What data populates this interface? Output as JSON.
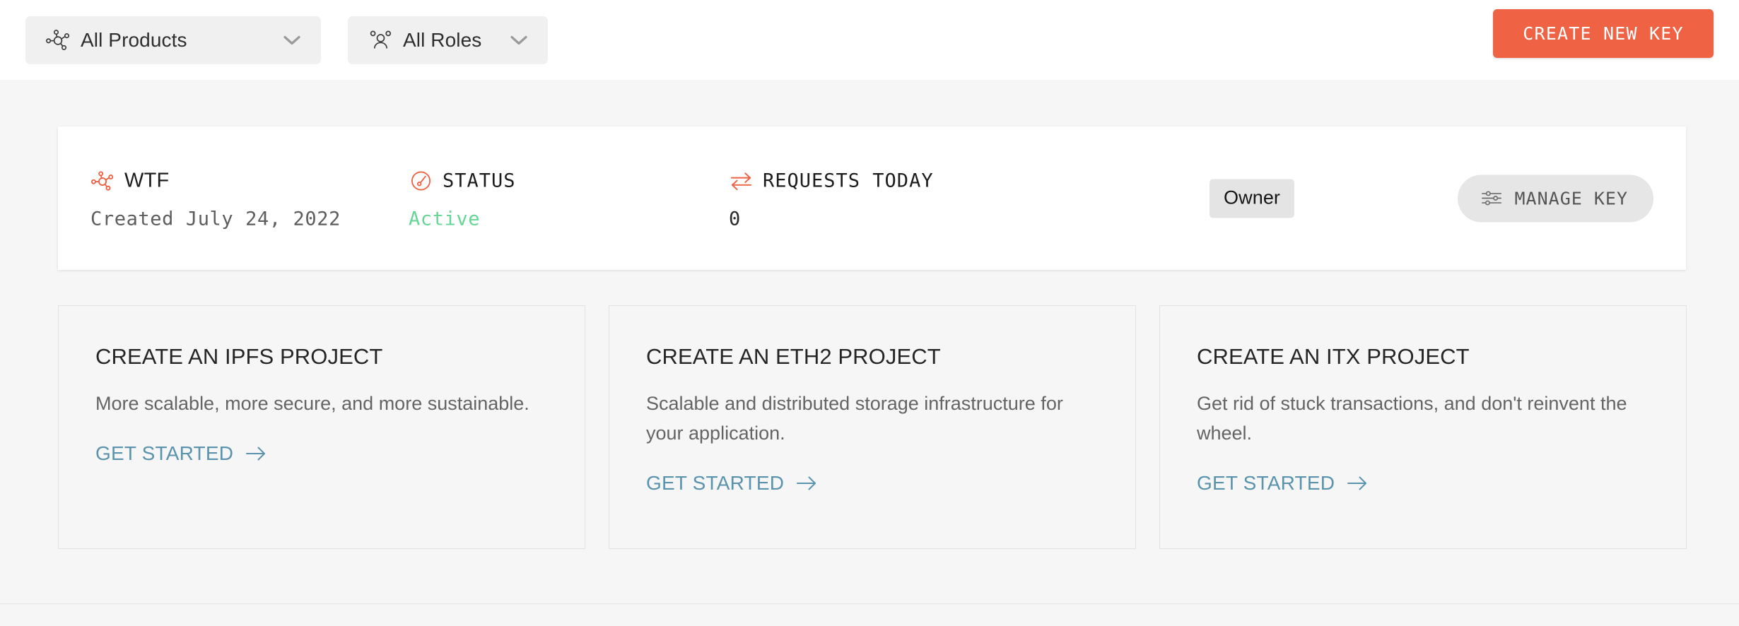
{
  "topbar": {
    "filters": [
      {
        "label": "All Products",
        "icon": "network-nodes-icon",
        "caret": "chevron-down-icon"
      },
      {
        "label": "All Roles",
        "icon": "users-group-icon",
        "caret": "chevron-down-icon"
      }
    ],
    "create_key_label": "CREATE NEW KEY"
  },
  "key_card": {
    "name_icon": "network-nodes-icon",
    "name": "WTF",
    "created": "Created July 24, 2022",
    "status_icon": "gauge-icon",
    "status_heading": "STATUS",
    "status_value": "Active",
    "requests_icon": "exchange-arrows-icon",
    "requests_heading": "REQUESTS TODAY",
    "requests_value": "0",
    "role_badge": "Owner",
    "manage_icon": "sliders-icon",
    "manage_label": "MANAGE KEY"
  },
  "project_cards": [
    {
      "title": "CREATE AN IPFS PROJECT",
      "description": "More scalable, more secure, and more sustainable.",
      "link_label": "GET STARTED",
      "link_arrow": "arrow-right-icon"
    },
    {
      "title": "CREATE AN ETH2 PROJECT",
      "description": "Scalable and distributed storage infrastructure for your application.",
      "link_label": "GET STARTED",
      "link_arrow": "arrow-right-icon"
    },
    {
      "title": "CREATE AN ITX PROJECT",
      "description": "Get rid of stuck transactions, and don't reinvent the wheel.",
      "link_label": "GET STARTED",
      "link_arrow": "arrow-right-icon"
    }
  ],
  "colors": {
    "accent_orange": "#ef6243",
    "status_green": "#66d695",
    "link_blue": "#5a93ad",
    "page_bg": "#f6f6f6",
    "topbar_bg": "#ffffff",
    "filter_pill_bg": "#f0f0f0",
    "badge_bg": "#e4e4e4",
    "manage_btn_bg": "#e6e6e6"
  }
}
